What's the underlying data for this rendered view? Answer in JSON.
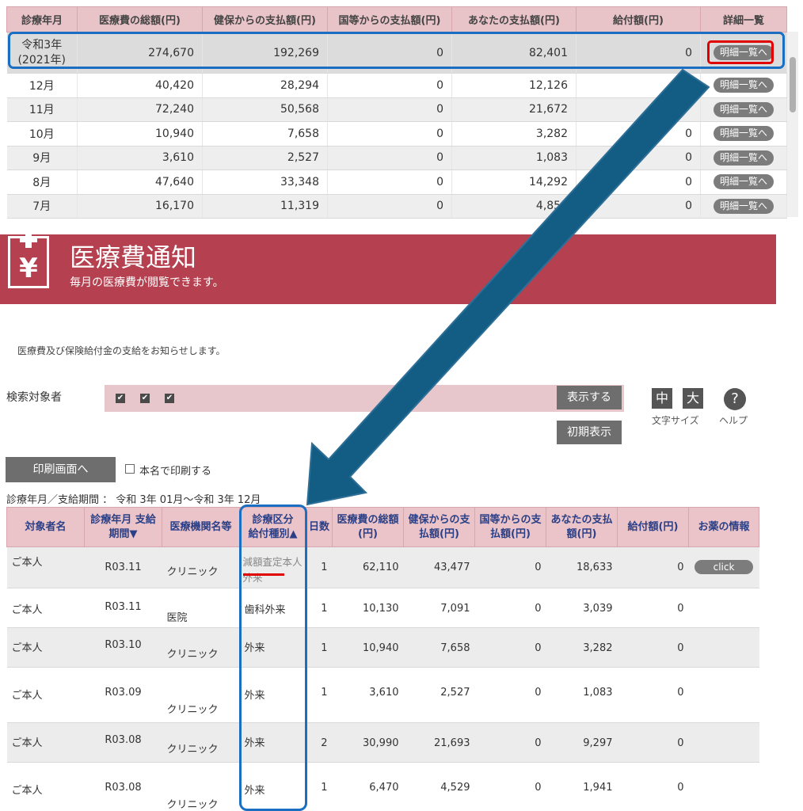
{
  "top_table": {
    "headers": [
      "診療年月",
      "医療費の総額(円)",
      "健保からの支払額(円)",
      "国等からの支払額(円)",
      "あなたの支払額(円)",
      "給付額(円)",
      "詳細一覧"
    ],
    "total_row": {
      "month": "令和3年\n(2021年)",
      "total": "274,670",
      "kenpo": "192,269",
      "kuni": "0",
      "self": "82,401",
      "benefit": "0",
      "button": "明細一覧へ"
    },
    "rows": [
      {
        "month": "12月",
        "total": "40,420",
        "kenpo": "28,294",
        "kuni": "0",
        "self": "12,126",
        "benefit": "",
        "button": "明細一覧へ"
      },
      {
        "month": "11月",
        "total": "72,240",
        "kenpo": "50,568",
        "kuni": "0",
        "self": "21,672",
        "benefit": "",
        "button": "明細一覧へ"
      },
      {
        "month": "10月",
        "total": "10,940",
        "kenpo": "7,658",
        "kuni": "0",
        "self": "3,282",
        "benefit": "0",
        "button": "明細一覧へ"
      },
      {
        "month": "9月",
        "total": "3,610",
        "kenpo": "2,527",
        "kuni": "0",
        "self": "1,083",
        "benefit": "0",
        "button": "明細一覧へ"
      },
      {
        "month": "8月",
        "total": "47,640",
        "kenpo": "33,348",
        "kuni": "0",
        "self": "14,292",
        "benefit": "0",
        "button": "明細一覧へ"
      },
      {
        "month": "7月",
        "total": "16,170",
        "kenpo": "11,319",
        "kuni": "0",
        "self": "4,851",
        "benefit": "0",
        "button": "明細一覧へ"
      }
    ]
  },
  "banner": {
    "title": "医療費通知",
    "subtitle": "毎月の医療費が閲覧できます。",
    "icon_glyph": "¥"
  },
  "intro_text": "医療費及び保険給付金の支給をお知らせします。",
  "search": {
    "label": "検索対象者",
    "show_button": "表示する",
    "reset_button": "初期表示",
    "check_mark": "✔"
  },
  "font_size": {
    "medium": "中",
    "large": "大",
    "label": "文字サイズ"
  },
  "help": {
    "glyph": "?",
    "label": "ヘルプ"
  },
  "print": {
    "button": "印刷画面へ",
    "checkbox_label": "本名で印刷する"
  },
  "period_text": "診療年月／支給期間 ： 令和 3年 01月～令和 3年 12月",
  "detail_table": {
    "headers": [
      {
        "l1": "対象者名",
        "l2": ""
      },
      {
        "l1": "診療年月 支給",
        "l2": "期間▼"
      },
      {
        "l1": "医療機関名等",
        "l2": ""
      },
      {
        "l1": "診療区分",
        "l2": "給付種別▲"
      },
      {
        "l1": "日数",
        "l2": ""
      },
      {
        "l1": "医療費の総額",
        "l2": "(円)"
      },
      {
        "l1": "健保からの支",
        "l2": "払額(円)"
      },
      {
        "l1": "国等からの支",
        "l2": "払額(円)"
      },
      {
        "l1": "あなたの支払",
        "l2": "額(円)"
      },
      {
        "l1": "給付額(円)",
        "l2": ""
      },
      {
        "l1": "お薬の情報",
        "l2": ""
      }
    ],
    "rows": [
      {
        "name": "ご本人",
        "period": "R03.11",
        "institution": "クリニック",
        "category": "減額査定",
        "category2": "本人",
        "category3": "外来",
        "days": "1",
        "total": "62,110",
        "kenpo": "43,477",
        "kuni": "0",
        "self": "18,633",
        "benefit": "0",
        "medicine": "click"
      },
      {
        "name": "ご本人",
        "period": "R03.11",
        "institution": "医院",
        "category": "歯科外来",
        "category2": "",
        "category3": "",
        "days": "1",
        "total": "10,130",
        "kenpo": "7,091",
        "kuni": "0",
        "self": "3,039",
        "benefit": "0",
        "medicine": ""
      },
      {
        "name": "ご本人",
        "period": "R03.10",
        "institution": "クリニック",
        "category": "外来",
        "category2": "",
        "category3": "",
        "days": "1",
        "total": "10,940",
        "kenpo": "7,658",
        "kuni": "0",
        "self": "3,282",
        "benefit": "0",
        "medicine": ""
      },
      {
        "name": "ご本人",
        "period": "R03.09",
        "institution": "クリニック",
        "category": "外来",
        "category2": "",
        "category3": "",
        "days": "1",
        "total": "3,610",
        "kenpo": "2,527",
        "kuni": "0",
        "self": "1,083",
        "benefit": "0",
        "medicine": ""
      },
      {
        "name": "ご本人",
        "period": "R03.08",
        "institution": "クリニック",
        "category": "外来",
        "category2": "",
        "category3": "",
        "days": "2",
        "total": "30,990",
        "kenpo": "21,693",
        "kuni": "0",
        "self": "9,297",
        "benefit": "0",
        "medicine": ""
      },
      {
        "name": "ご本人",
        "period": "R03.08",
        "institution": "クリニック",
        "category": "外来",
        "category2": "",
        "category3": "",
        "days": "1",
        "total": "6,470",
        "kenpo": "4,529",
        "kuni": "0",
        "self": "1,941",
        "benefit": "0",
        "medicine": ""
      }
    ]
  },
  "colors": {
    "banner": "#b5404f",
    "header_pink": "#e8c3c8",
    "highlight_blue": "#1a6fc2",
    "highlight_red": "#e00000",
    "arrow": "#135d84"
  }
}
